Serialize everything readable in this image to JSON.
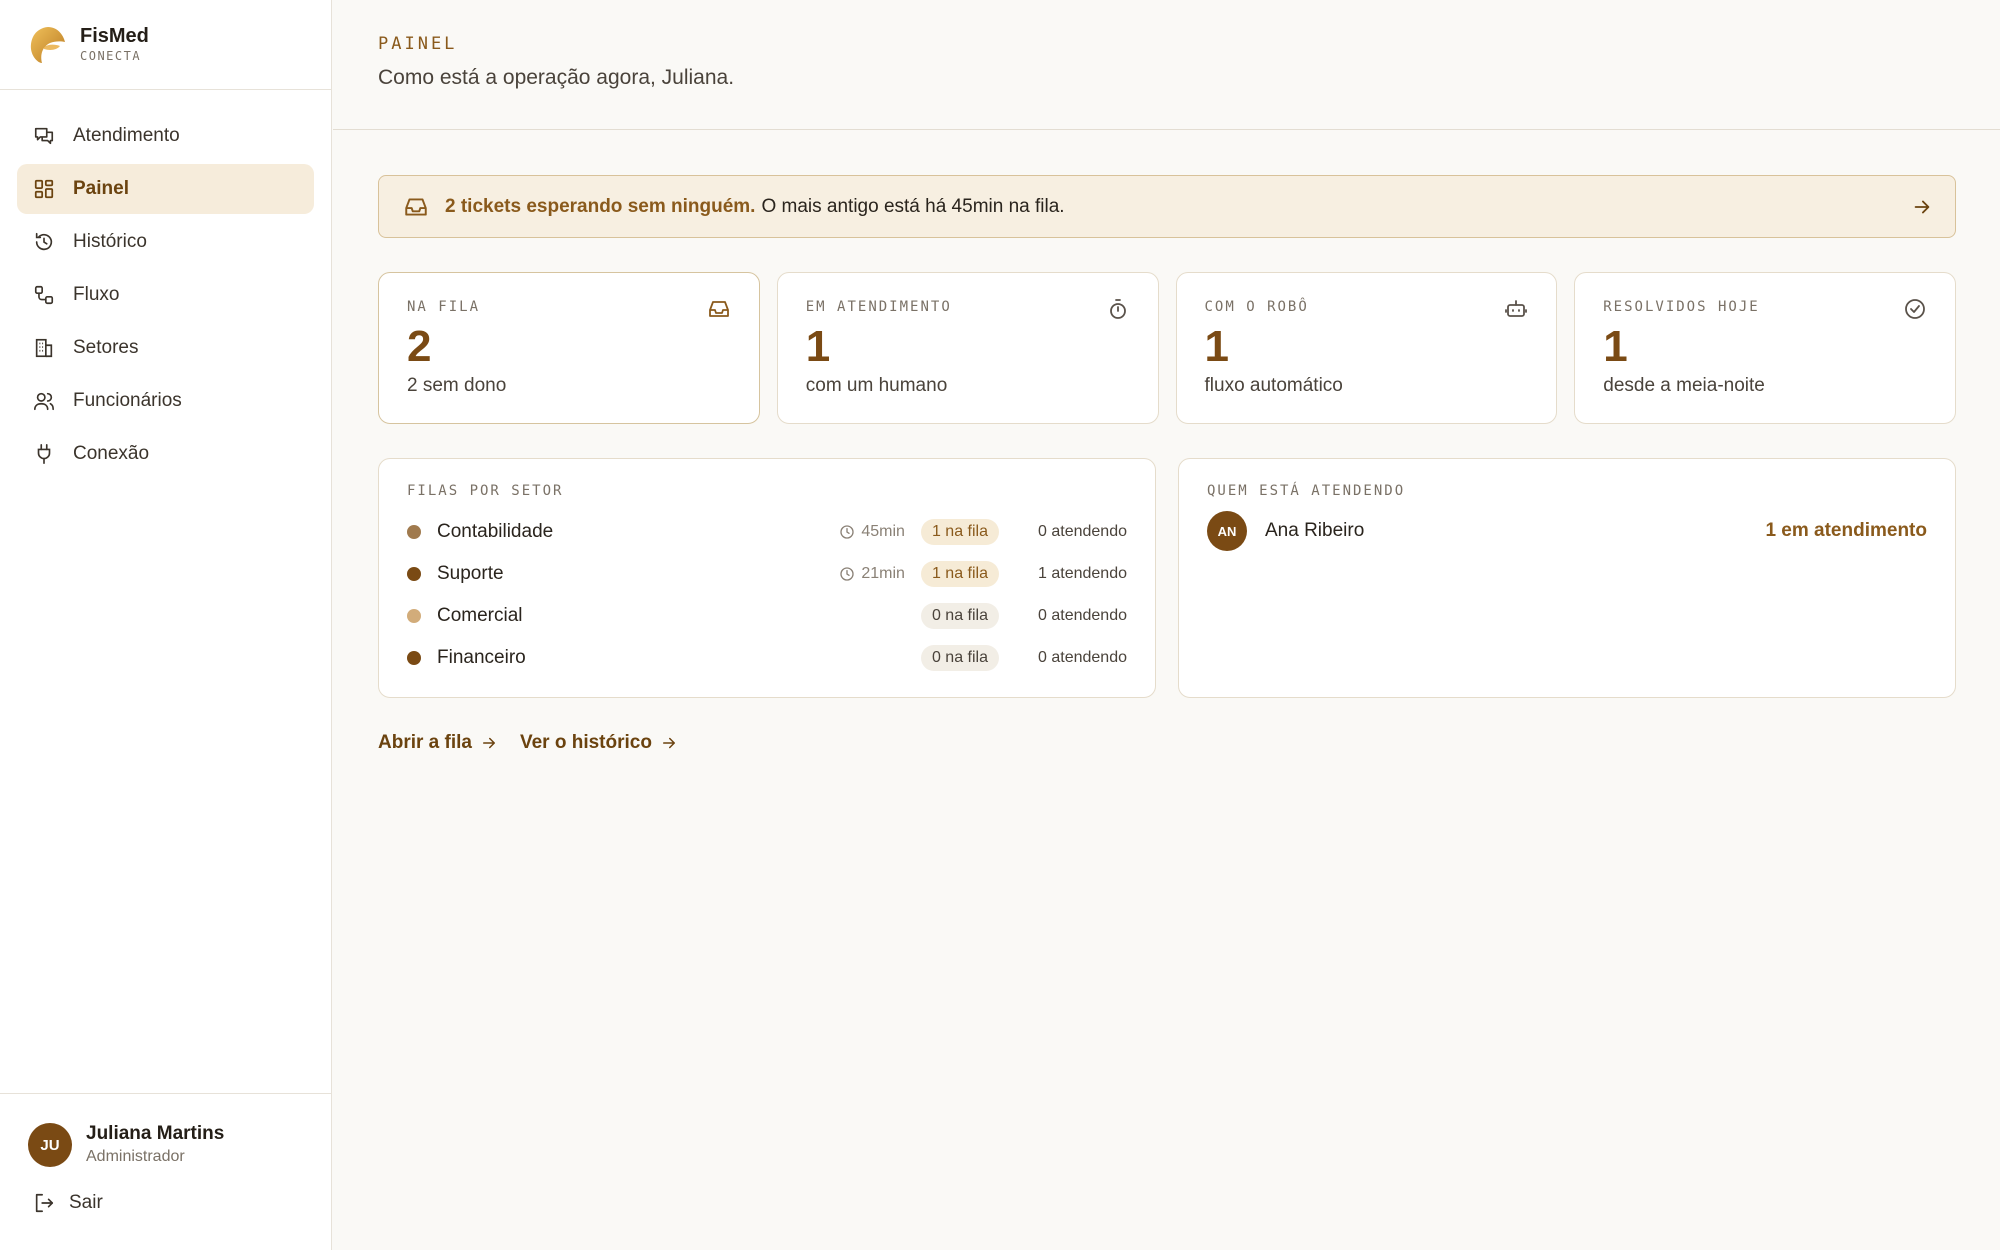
{
  "brand": {
    "name": "FisMed",
    "sub": "CONECTA",
    "accent": "#8a5a1c"
  },
  "sidebar": {
    "items": [
      {
        "label": "Atendimento",
        "icon": "chat-icon"
      },
      {
        "label": "Painel",
        "icon": "grid-icon",
        "active": true
      },
      {
        "label": "Histórico",
        "icon": "history-icon"
      },
      {
        "label": "Fluxo",
        "icon": "flow-icon"
      },
      {
        "label": "Setores",
        "icon": "building-icon"
      },
      {
        "label": "Funcionários",
        "icon": "users-icon"
      },
      {
        "label": "Conexão",
        "icon": "plug-icon"
      }
    ]
  },
  "user": {
    "initials": "JU",
    "name": "Juliana Martins",
    "role": "Administrador",
    "logout_label": "Sair"
  },
  "header": {
    "eyebrow": "PAINEL",
    "subtitle": "Como está a operação agora, Juliana."
  },
  "alert": {
    "strong": "2 tickets esperando sem ninguém.",
    "text": "O mais antigo está há 45min na fila."
  },
  "stats": [
    {
      "label": "NA FILA",
      "value": "2",
      "desc": "2 sem dono",
      "icon": "inbox-icon"
    },
    {
      "label": "EM ATENDIMENTO",
      "value": "1",
      "desc": "com um humano",
      "icon": "stopwatch-icon"
    },
    {
      "label": "COM O ROBÔ",
      "value": "1",
      "desc": "fluxo automático",
      "icon": "robot-icon"
    },
    {
      "label": "RESOLVIDOS HOJE",
      "value": "1",
      "desc": "desde a meia-noite",
      "icon": "check-circle-icon"
    }
  ],
  "sectors": {
    "title": "FILAS POR SETOR",
    "rows": [
      {
        "name": "Contabilidade",
        "color": "#a07a4e",
        "wait": "45min",
        "queue": "1 na fila",
        "serving": "0 atendendo"
      },
      {
        "name": "Suporte",
        "color": "#7a4a14",
        "wait": "21min",
        "queue": "1 na fila",
        "serving": "1 atendendo"
      },
      {
        "name": "Comercial",
        "color": "#d2ac7a",
        "wait": "",
        "queue": "0 na fila",
        "serving": "0 atendendo"
      },
      {
        "name": "Financeiro",
        "color": "#7a4a14",
        "wait": "",
        "queue": "0 na fila",
        "serving": "0 atendendo"
      }
    ]
  },
  "agents": {
    "title": "QUEM ESTÁ ATENDENDO",
    "rows": [
      {
        "initials": "AN",
        "name": "Ana Ribeiro",
        "count": "1 em atendimento"
      }
    ]
  },
  "links": {
    "queue": "Abrir a fila",
    "history": "Ver o histórico"
  }
}
